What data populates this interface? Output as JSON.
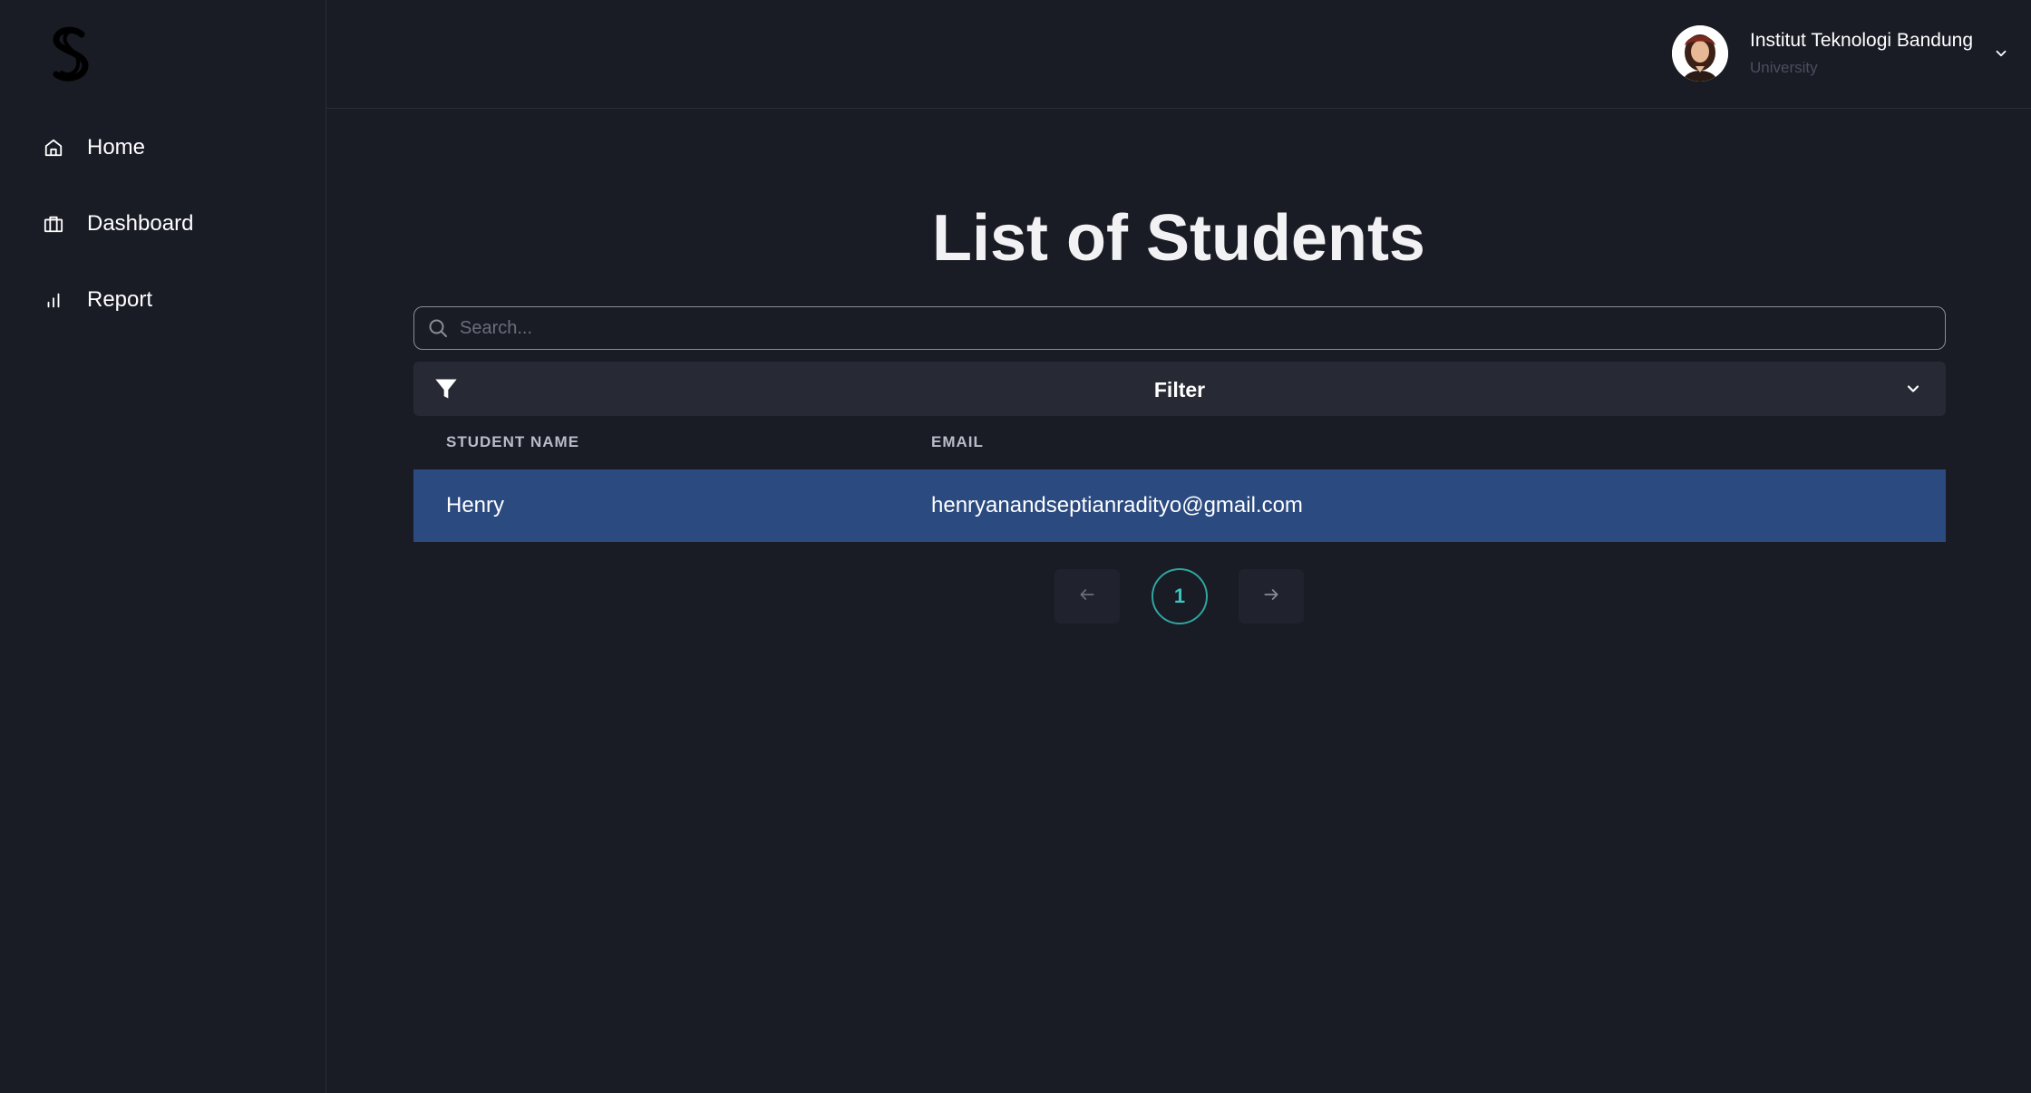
{
  "sidebar": {
    "items": [
      {
        "label": "Home",
        "icon": "home-icon"
      },
      {
        "label": "Dashboard",
        "icon": "briefcase-icon"
      },
      {
        "label": "Report",
        "icon": "bar-chart-icon"
      }
    ]
  },
  "header": {
    "user_name": "Institut Teknologi Bandung",
    "user_role": "University"
  },
  "main": {
    "title": "List of Students",
    "search": {
      "placeholder": "Search...",
      "value": ""
    },
    "filter_label": "Filter",
    "table": {
      "columns": [
        "STUDENT NAME",
        "EMAIL"
      ],
      "rows": [
        {
          "name": "Henry",
          "email": "henryanandseptianradityo@gmail.com"
        }
      ]
    },
    "pagination": {
      "current_page": "1"
    }
  },
  "colors": {
    "background": "#191b25",
    "selected_row": "#2b4a80",
    "accent": "#3cc4bb"
  }
}
